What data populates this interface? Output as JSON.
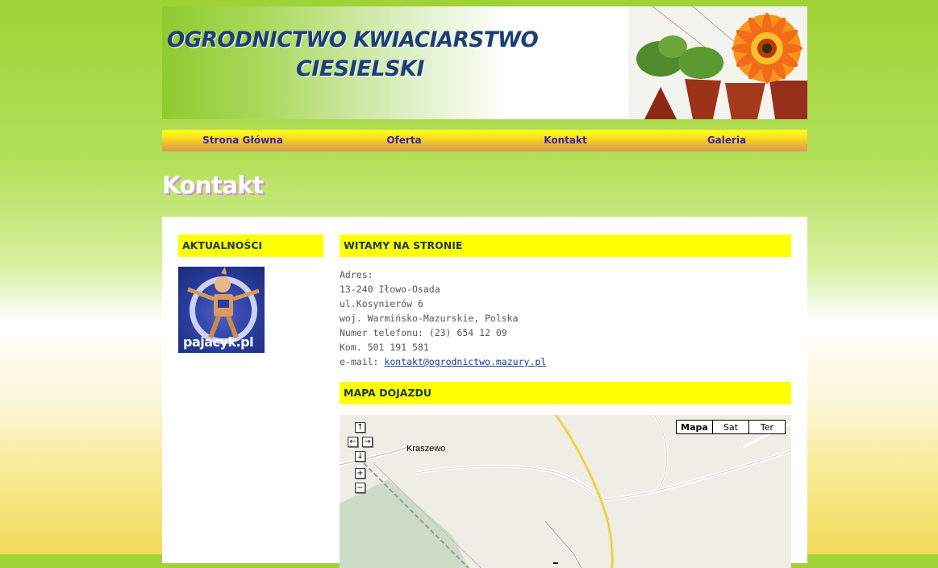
{
  "header": {
    "title_line1": "OGRODNICTWO KWIACIARSTWO",
    "title_line2": "CIESIELSKI"
  },
  "nav": {
    "items": [
      {
        "label": "Strona Główna"
      },
      {
        "label": "Oferta"
      },
      {
        "label": "Kontakt"
      },
      {
        "label": "Galeria"
      }
    ]
  },
  "page": {
    "title": "Kontakt"
  },
  "sidebar": {
    "news_heading": "AKTUALNOŚCI",
    "banner_text": "pajacyk.pl"
  },
  "main": {
    "welcome_heading": "WITAMY NA STRONIE",
    "address": {
      "label": "Adres:",
      "postal": "13-240 Iłowo-Osada",
      "street": "ul.Kosynierów 6",
      "region": "woj. Warmińsko-Mazurskie, Polska",
      "phone": "Numer telefonu: (23) 654 12 09",
      "mobile": "Kom. 501 191 581",
      "email_label": "e-mail:",
      "email": "kontakt@ogrodnictwo.mazury.pl"
    },
    "map_heading": "MAPA DOJAZDU"
  },
  "map": {
    "controls": {
      "up": "↑",
      "left": "←",
      "right": "→",
      "down": "↓",
      "zoom_in": "+",
      "zoom_out": "−"
    },
    "types": [
      {
        "label": "Mapa",
        "active": true
      },
      {
        "label": "Sat",
        "active": false
      },
      {
        "label": "Ter",
        "active": false
      }
    ],
    "town_label": "Kraszewo"
  }
}
